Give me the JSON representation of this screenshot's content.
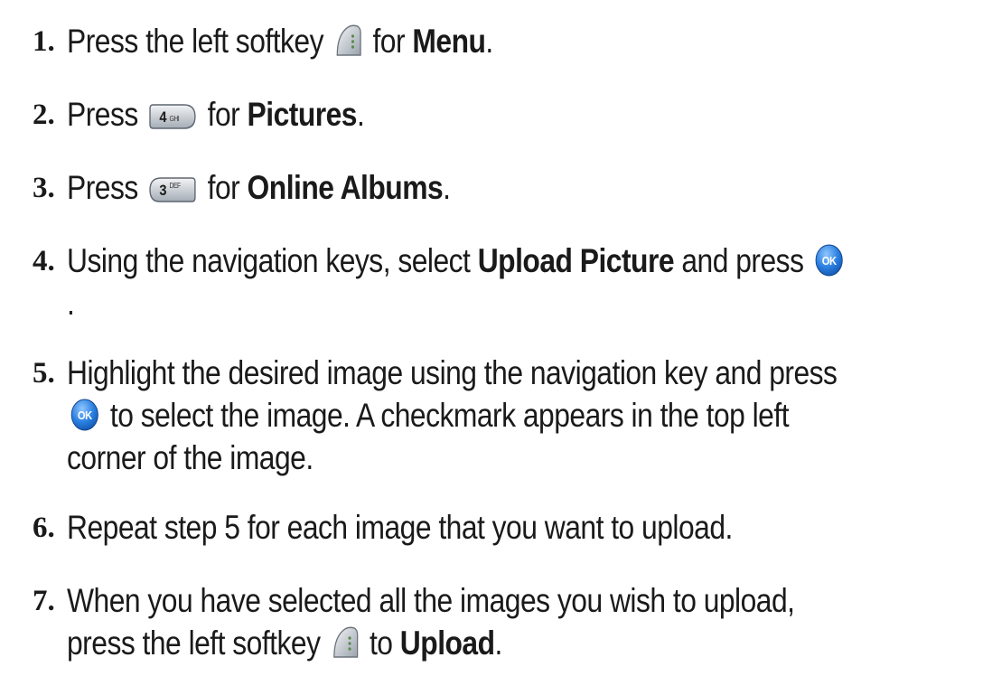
{
  "steps": [
    {
      "number": "1.",
      "parts": {
        "a": "Press the left softkey ",
        "b": " for ",
        "c": "Menu",
        "d": "."
      },
      "icons": [
        "softkey-left-icon"
      ]
    },
    {
      "number": "2.",
      "parts": {
        "a": "Press ",
        "b": " for ",
        "c": "Pictures",
        "d": "."
      },
      "icons": [
        "key-4-ghi-icon"
      ],
      "key_label": {
        "digit": "4",
        "letters": "GHI"
      }
    },
    {
      "number": "3.",
      "parts": {
        "a": "Press ",
        "b": " for ",
        "c": "Online Albums",
        "d": "."
      },
      "icons": [
        "key-3-def-icon"
      ],
      "key_label": {
        "digit": "3",
        "letters": "DEF"
      }
    },
    {
      "number": "4.",
      "parts": {
        "a": "Using the navigation keys, select ",
        "b": "Upload Picture",
        "c": " and press ",
        "d": "."
      },
      "icons": [
        "ok-key-icon"
      ]
    },
    {
      "number": "5.",
      "parts": {
        "a": "Highlight the desired image using the navigation key and press ",
        "b": " to select the image. A checkmark appears in the top left corner of the image."
      },
      "icons": [
        "ok-key-icon"
      ]
    },
    {
      "number": "6.",
      "parts": {
        "a": "Repeat step 5 for each image that you want to upload."
      }
    },
    {
      "number": "7.",
      "parts": {
        "a": "When you have selected all the images you wish to upload, press the left softkey ",
        "b": " to ",
        "c": "Upload",
        "d": "."
      },
      "icons": [
        "softkey-left-icon"
      ]
    }
  ],
  "ok_key_label": "OK",
  "colors": {
    "text": "#1a1a1a",
    "ok_key_blue": "#2a7fe0",
    "softkey_gray": "#b8bec6"
  }
}
